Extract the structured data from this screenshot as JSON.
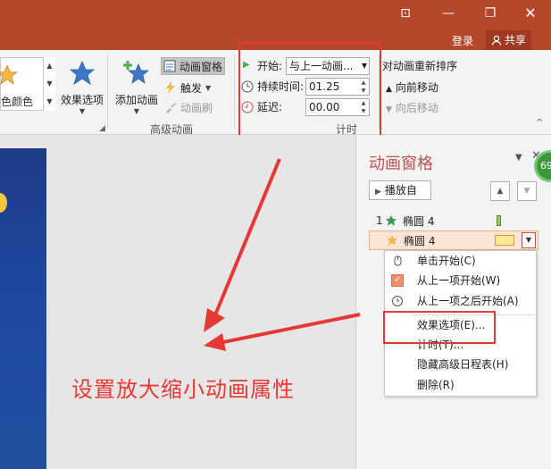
{
  "titlebar": {
    "controls": [
      "ribbon-display-options",
      "minimize",
      "restore",
      "close"
    ],
    "login": "登录",
    "share": "共享"
  },
  "ribbon": {
    "gallery_label": "色颜色",
    "effect_options": "效果选项",
    "add_animation": "添加动画",
    "animation_pane": "动画窗格",
    "trigger": "触发",
    "animation_painter": "动画刷",
    "advanced_animation": "高级动画",
    "timing": {
      "start_label": "开始:",
      "start_value": "与上一动画...",
      "duration_label": "持续时间:",
      "duration_value": "01.25",
      "delay_label": "延迟:",
      "delay_value": "00.00",
      "group_label": "计时"
    },
    "reorder": {
      "title": "对动画重新排序",
      "move_earlier": "向前移动",
      "move_later": "向后移动"
    }
  },
  "slide": {
    "caption": "设置放大缩小动画属性"
  },
  "pane": {
    "title": "动画窗格",
    "play_from": "播放自",
    "badge": "69",
    "items": [
      {
        "index": "1",
        "name": "椭圆 4"
      },
      {
        "index": "",
        "name": "椭圆 4"
      }
    ]
  },
  "context_menu": {
    "items": [
      {
        "label": "单击开始(C)",
        "icon": "mouse-click-icon"
      },
      {
        "label": "从上一项开始(W)",
        "icon": "check-icon"
      },
      {
        "label": "从上一项之后开始(A)",
        "icon": "clock-icon"
      },
      {
        "label": "效果选项(E)...",
        "icon": ""
      },
      {
        "label": "计时(T)...",
        "icon": ""
      },
      {
        "label": "隐藏高级日程表(H)",
        "icon": ""
      },
      {
        "label": "删除(R)",
        "icon": ""
      }
    ]
  },
  "colors": {
    "titlebar": "#b7472a",
    "highlight": "#e53935",
    "pane_title": "#c0504d"
  }
}
